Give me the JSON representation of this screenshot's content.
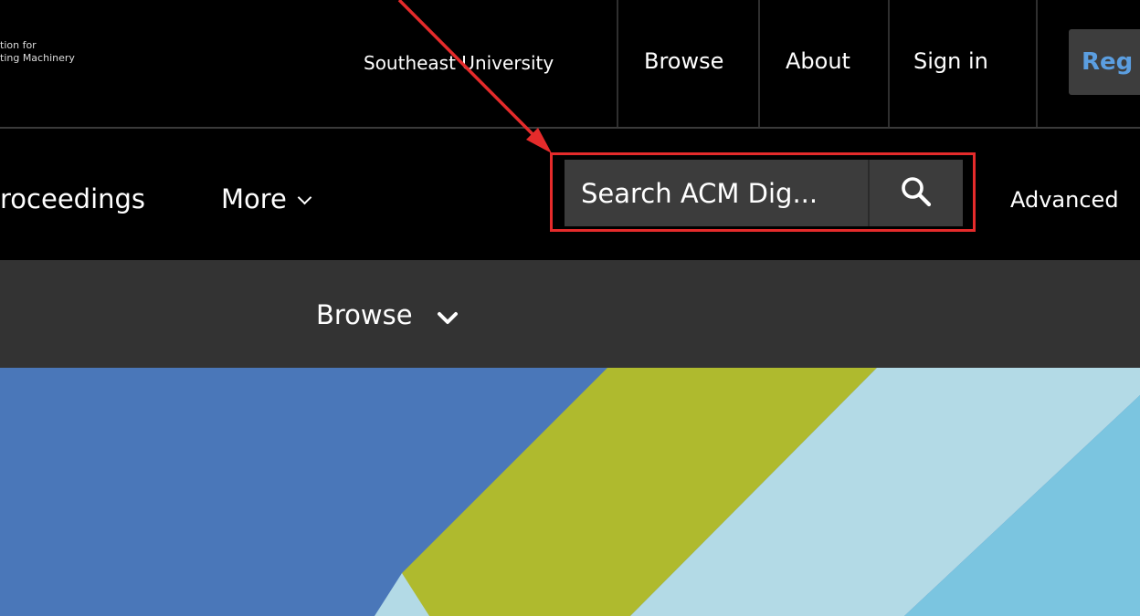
{
  "header": {
    "org_line1": "tion for",
    "org_line2": "ting Machinery",
    "institution": "Southeast University",
    "links": [
      "Browse",
      "About",
      "Sign in"
    ],
    "register_label": "Reg"
  },
  "nav": {
    "proceedings_label": "roceedings",
    "more_label": "More",
    "search_placeholder": "Search ACM Dig...",
    "advanced_label": "Advanced"
  },
  "subnav": {
    "browse_label": "Browse"
  },
  "colors": {
    "background": "#000000",
    "subbar": "#333333",
    "search_bg": "#3c3c3c",
    "highlight": "#e52b2b",
    "register_text": "#5b9ee0",
    "hero_blue": "#4a77b9",
    "hero_olive": "#afba2e",
    "hero_light_blue": "#b3dae6",
    "hero_sky": "#7bc5e0"
  },
  "icons": {
    "search": "search-icon",
    "more_chevron": "chevron-down-icon",
    "browse_chevron": "chevron-down-icon"
  }
}
